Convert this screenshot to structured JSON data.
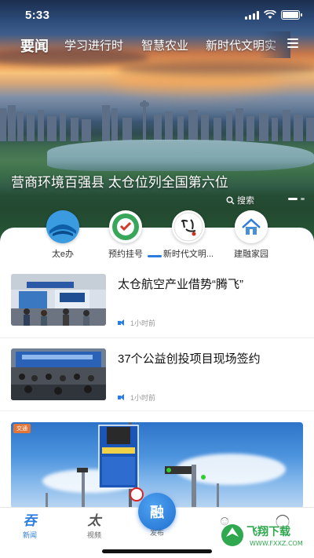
{
  "status_bar": {
    "time": "5:33"
  },
  "tabs": [
    {
      "label": "要闻",
      "active": true
    },
    {
      "label": "学习进行时",
      "active": false
    },
    {
      "label": "智慧农业",
      "active": false
    },
    {
      "label": "新时代文明实",
      "active": false
    }
  ],
  "hero": {
    "headline": "营商环境百强县  太仓位列全国第六位",
    "search_label": "搜索"
  },
  "quick_access": [
    {
      "label": "太e办",
      "icon": "taie-icon"
    },
    {
      "label": "预约挂号",
      "icon": "appointment-icon"
    },
    {
      "label": "新时代文明...",
      "icon": "civilization-icon"
    },
    {
      "label": "建融家园",
      "icon": "home-icon"
    }
  ],
  "news": [
    {
      "title": "太仓航空产业借势“腾飞”",
      "time": "1小时前"
    },
    {
      "title": "37个公益创投项目现场签约",
      "time": "1小时前"
    }
  ],
  "big_card": {
    "tag": "交通"
  },
  "bottom_nav": [
    {
      "label": "新闻",
      "active": true,
      "icon": "news-icon"
    },
    {
      "label": "视频",
      "active": false,
      "icon": "video-icon"
    },
    {
      "label": "发布",
      "active": false,
      "icon": "publish-icon"
    }
  ],
  "watermark": {
    "brand": "飞翔下载",
    "url": "WWW.FXXZ.COM"
  },
  "colors": {
    "accent": "#2b7de0"
  }
}
